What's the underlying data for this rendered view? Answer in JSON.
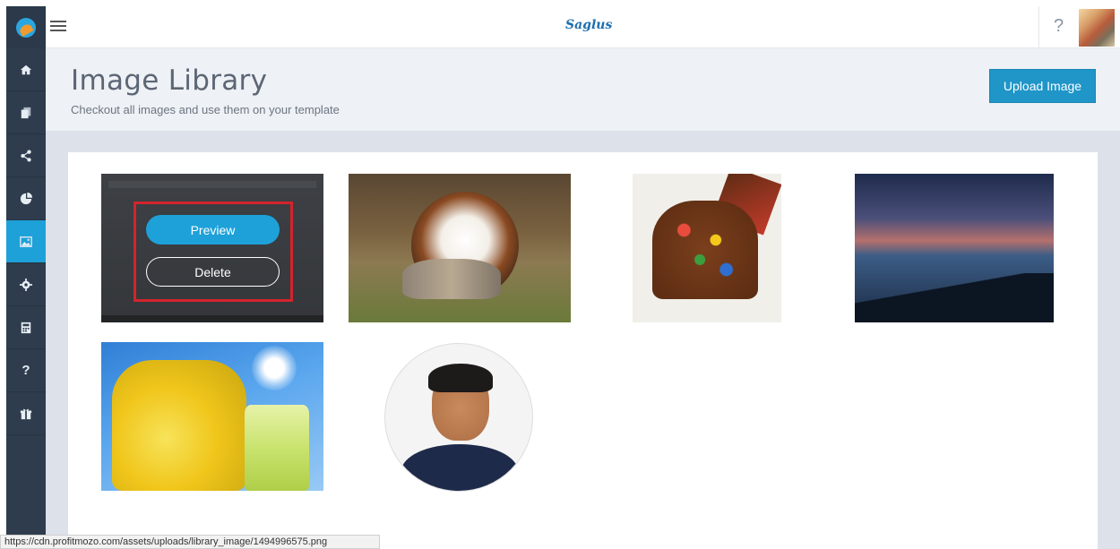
{
  "app": {
    "brand": "Saglus"
  },
  "topbar": {
    "help_label": "?"
  },
  "sidebar": {
    "items": [
      {
        "name": "home",
        "icon": "home-icon"
      },
      {
        "name": "pages",
        "icon": "pages-icon"
      },
      {
        "name": "share",
        "icon": "share-icon"
      },
      {
        "name": "reports",
        "icon": "pie-chart-icon"
      },
      {
        "name": "images",
        "icon": "image-icon",
        "active": true
      },
      {
        "name": "settings",
        "icon": "gear-icon"
      },
      {
        "name": "billing",
        "icon": "calculator-icon"
      },
      {
        "name": "help",
        "icon": "question-icon",
        "label": "?"
      },
      {
        "name": "gifts",
        "icon": "gift-icon"
      }
    ]
  },
  "header": {
    "title": "Image Library",
    "subtitle": "Checkout all images and use them on your template",
    "upload_label": "Upload Image"
  },
  "library": {
    "hover_actions": {
      "preview_label": "Preview",
      "delete_label": "Delete"
    },
    "images": [
      {
        "name": "screenshot"
      },
      {
        "name": "dog-and-kittens"
      },
      {
        "name": "candy-cake"
      },
      {
        "name": "sunset-sea"
      },
      {
        "name": "lemonade"
      },
      {
        "name": "profile-portrait"
      }
    ]
  },
  "statusbar": {
    "url": "https://cdn.profitmozo.com/assets/uploads/library_image/1494996575.png"
  },
  "colors": {
    "sidebar_bg": "#2e3c4e",
    "accent": "#1ea1d9",
    "upload_button": "#1f95c8",
    "highlight": "#d3242b"
  }
}
